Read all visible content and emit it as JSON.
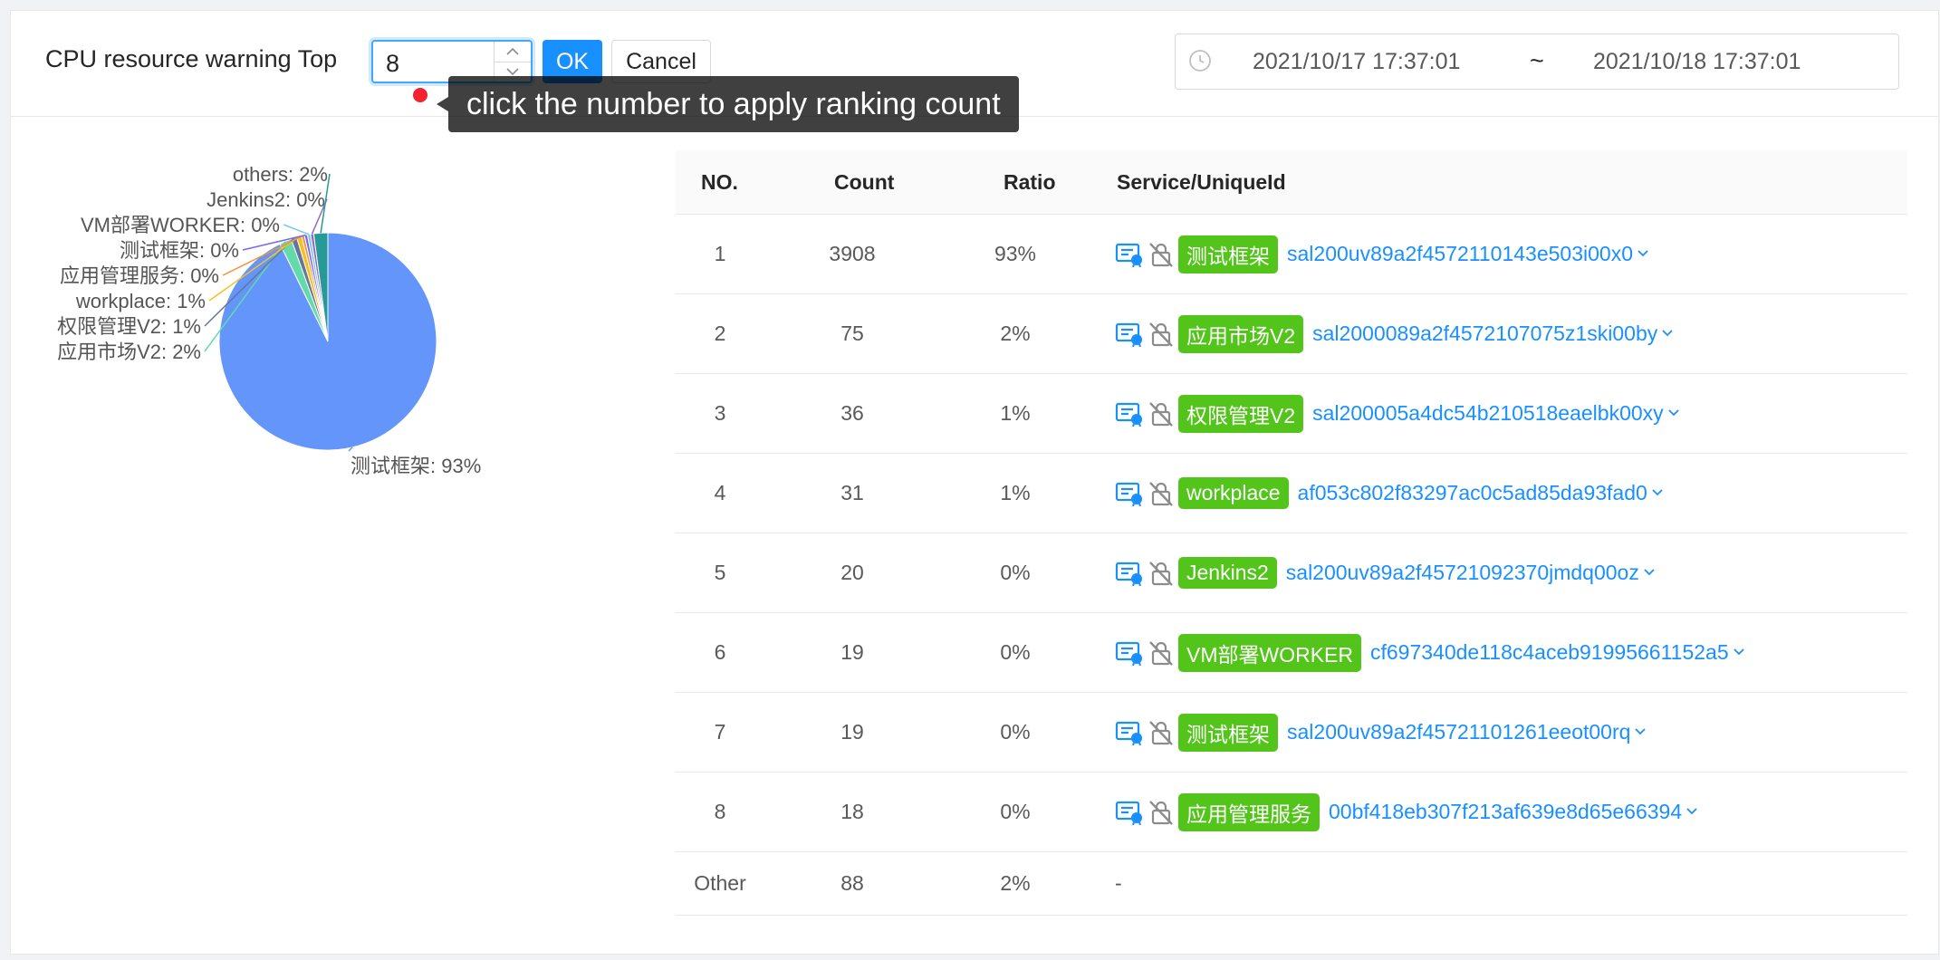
{
  "header": {
    "title": "CPU resource warning Top",
    "top_value": "8",
    "ok_label": "OK",
    "cancel_label": "Cancel",
    "tooltip": "click the number to apply ranking count",
    "date_start": "2021/10/17 17:37:01",
    "date_separator": "~",
    "date_end": "2021/10/18 17:37:01"
  },
  "icons": {
    "clock": "clock-icon",
    "up": "chevron-up-icon",
    "down": "chevron-down-icon",
    "certificate": "certificate-icon",
    "lock": "lock-off-icon"
  },
  "colors": {
    "accent": "#1890ff",
    "tag": "#52c41a",
    "alert_dot": "#f5222d"
  },
  "chart_data": {
    "type": "pie",
    "slices": [
      {
        "label": "测试框架: 93%",
        "value": 3908,
        "color": "#6395fa"
      },
      {
        "label": "应用市场V2: 2%",
        "value": 75,
        "color": "#63daab"
      },
      {
        "label": "权限管理V2: 1%",
        "value": 36,
        "color": "#657798"
      },
      {
        "label": "workplace: 1%",
        "value": 31,
        "color": "#f6c022"
      },
      {
        "label": "应用管理服务: 0%",
        "value": 18,
        "color": "#f6903d"
      },
      {
        "label": "测试框架: 0%",
        "value": 19,
        "color": "#7666f9"
      },
      {
        "label": "VM部署WORKER: 0%",
        "value": 19,
        "color": "#74cbed"
      },
      {
        "label": "Jenkins2: 0%",
        "value": 20,
        "color": "#9967bd"
      },
      {
        "label": "others: 2%",
        "value": 88,
        "color": "#269a99"
      }
    ]
  },
  "table": {
    "headers": {
      "no": "NO.",
      "count": "Count",
      "ratio": "Ratio",
      "service": "Service/UniqueId"
    },
    "rows": [
      {
        "no": "1",
        "count": "3908",
        "ratio": "93%",
        "service": "测试框架",
        "uid": "sal200uv89a2f4572110143e503i00x0"
      },
      {
        "no": "2",
        "count": "75",
        "ratio": "2%",
        "service": "应用市场V2",
        "uid": "sal2000089a2f4572107075z1ski00by"
      },
      {
        "no": "3",
        "count": "36",
        "ratio": "1%",
        "service": "权限管理V2",
        "uid": "sal200005a4dc54b210518eaelbk00xy"
      },
      {
        "no": "4",
        "count": "31",
        "ratio": "1%",
        "service": "workplace",
        "uid": "af053c802f83297ac0c5ad85da93fad0"
      },
      {
        "no": "5",
        "count": "20",
        "ratio": "0%",
        "service": "Jenkins2",
        "uid": "sal200uv89a2f45721092370jmdq00oz"
      },
      {
        "no": "6",
        "count": "19",
        "ratio": "0%",
        "service": "VM部署WORKER",
        "uid": "cf697340de118c4aceb91995661152a5"
      },
      {
        "no": "7",
        "count": "19",
        "ratio": "0%",
        "service": "测试框架",
        "uid": "sal200uv89a2f45721101261eeot00rq"
      },
      {
        "no": "8",
        "count": "18",
        "ratio": "0%",
        "service": "应用管理服务",
        "uid": "00bf418eb307f213af639e8d65e66394"
      }
    ],
    "other": {
      "no": "Other",
      "count": "88",
      "ratio": "2%",
      "service": "-"
    }
  }
}
